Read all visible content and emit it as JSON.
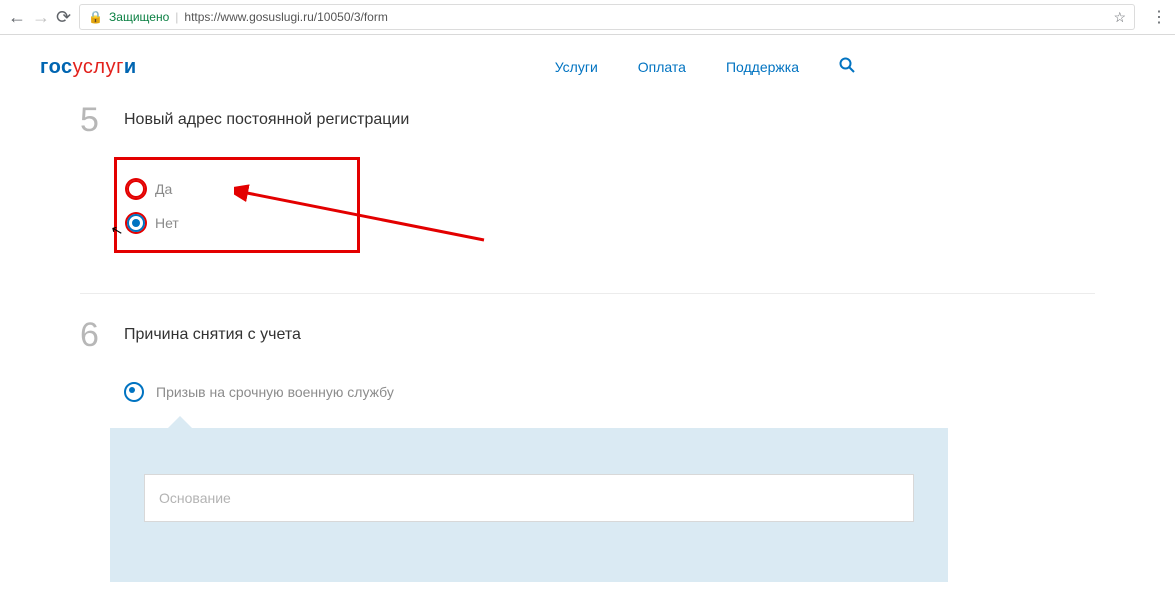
{
  "browser": {
    "secure_label": "Защищено",
    "url": "https://www.gosuslugi.ru/10050/3/form"
  },
  "logo": {
    "p1": "гос",
    "p2": "услуг",
    "p3": "и"
  },
  "nav": {
    "services": "Услуги",
    "payment": "Оплата",
    "support": "Поддержка"
  },
  "step5": {
    "num": "5",
    "title": "Новый адрес постоянной регистрации",
    "yes": "Да",
    "no": "Нет"
  },
  "step6": {
    "num": "6",
    "title": "Причина снятия с учета",
    "reason": "Призыв на срочную военную службу",
    "field_placeholder": "Основание"
  }
}
